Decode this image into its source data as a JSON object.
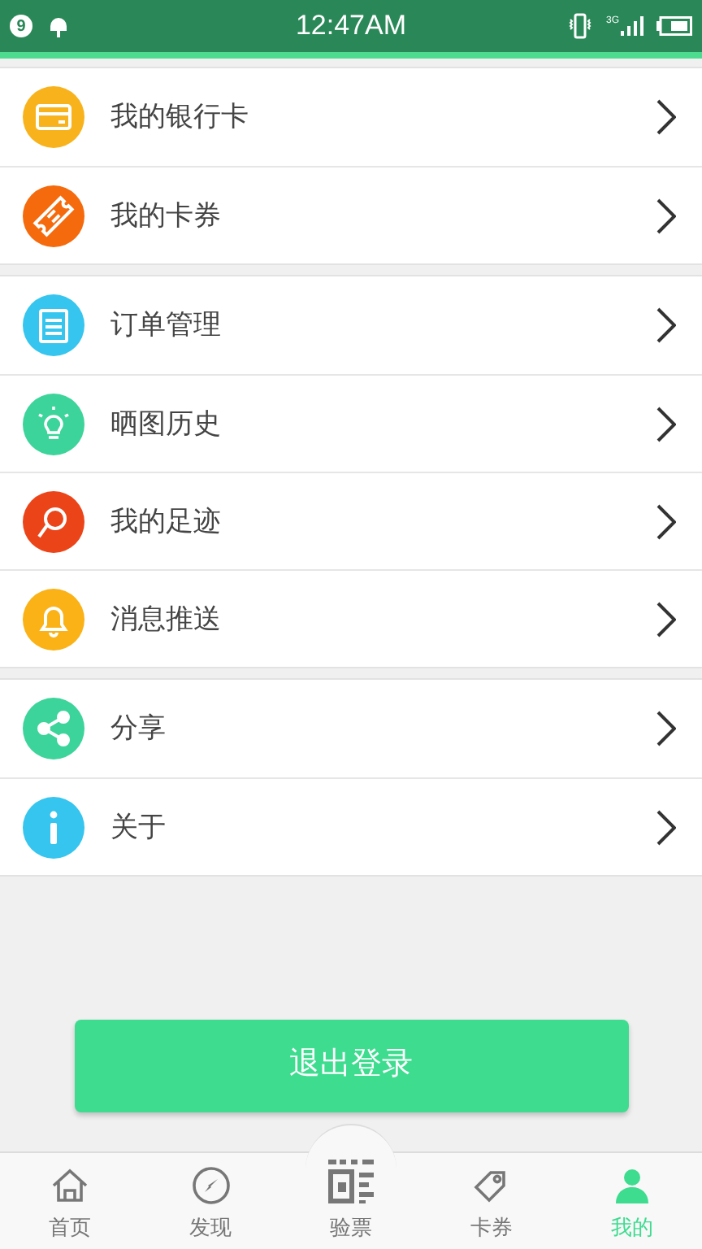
{
  "status_bar": {
    "notification_count": "9",
    "time": "12:47AM",
    "network": "3G"
  },
  "menu_groups": [
    {
      "items": [
        {
          "label": "我的银行卡",
          "kind": "card",
          "color": "#f8b31c"
        },
        {
          "label": "我的卡券",
          "kind": "ticket",
          "color": "#f46a0c"
        }
      ]
    },
    {
      "items": [
        {
          "label": "订单管理",
          "kind": "clipboard",
          "color": "#35c5ee"
        },
        {
          "label": "晒图历史",
          "kind": "bulb",
          "color": "#3cd49a"
        },
        {
          "label": "我的足迹",
          "kind": "pin",
          "color": "#ec4419"
        },
        {
          "label": "消息推送",
          "kind": "bell",
          "color": "#fab216"
        }
      ]
    },
    {
      "items": [
        {
          "label": "分享",
          "kind": "share",
          "color": "#3cd49a"
        },
        {
          "label": "关于",
          "kind": "info",
          "color": "#35c5ee"
        }
      ]
    }
  ],
  "logout_button": "退出登录",
  "tabs": [
    {
      "label": "首页",
      "kind": "home",
      "selected": false
    },
    {
      "label": "发现",
      "kind": "compass",
      "selected": false
    },
    {
      "label": "验票",
      "kind": "scan",
      "selected": false
    },
    {
      "label": "卡券",
      "kind": "tag",
      "selected": false
    },
    {
      "label": "我的",
      "kind": "user",
      "selected": true
    }
  ]
}
